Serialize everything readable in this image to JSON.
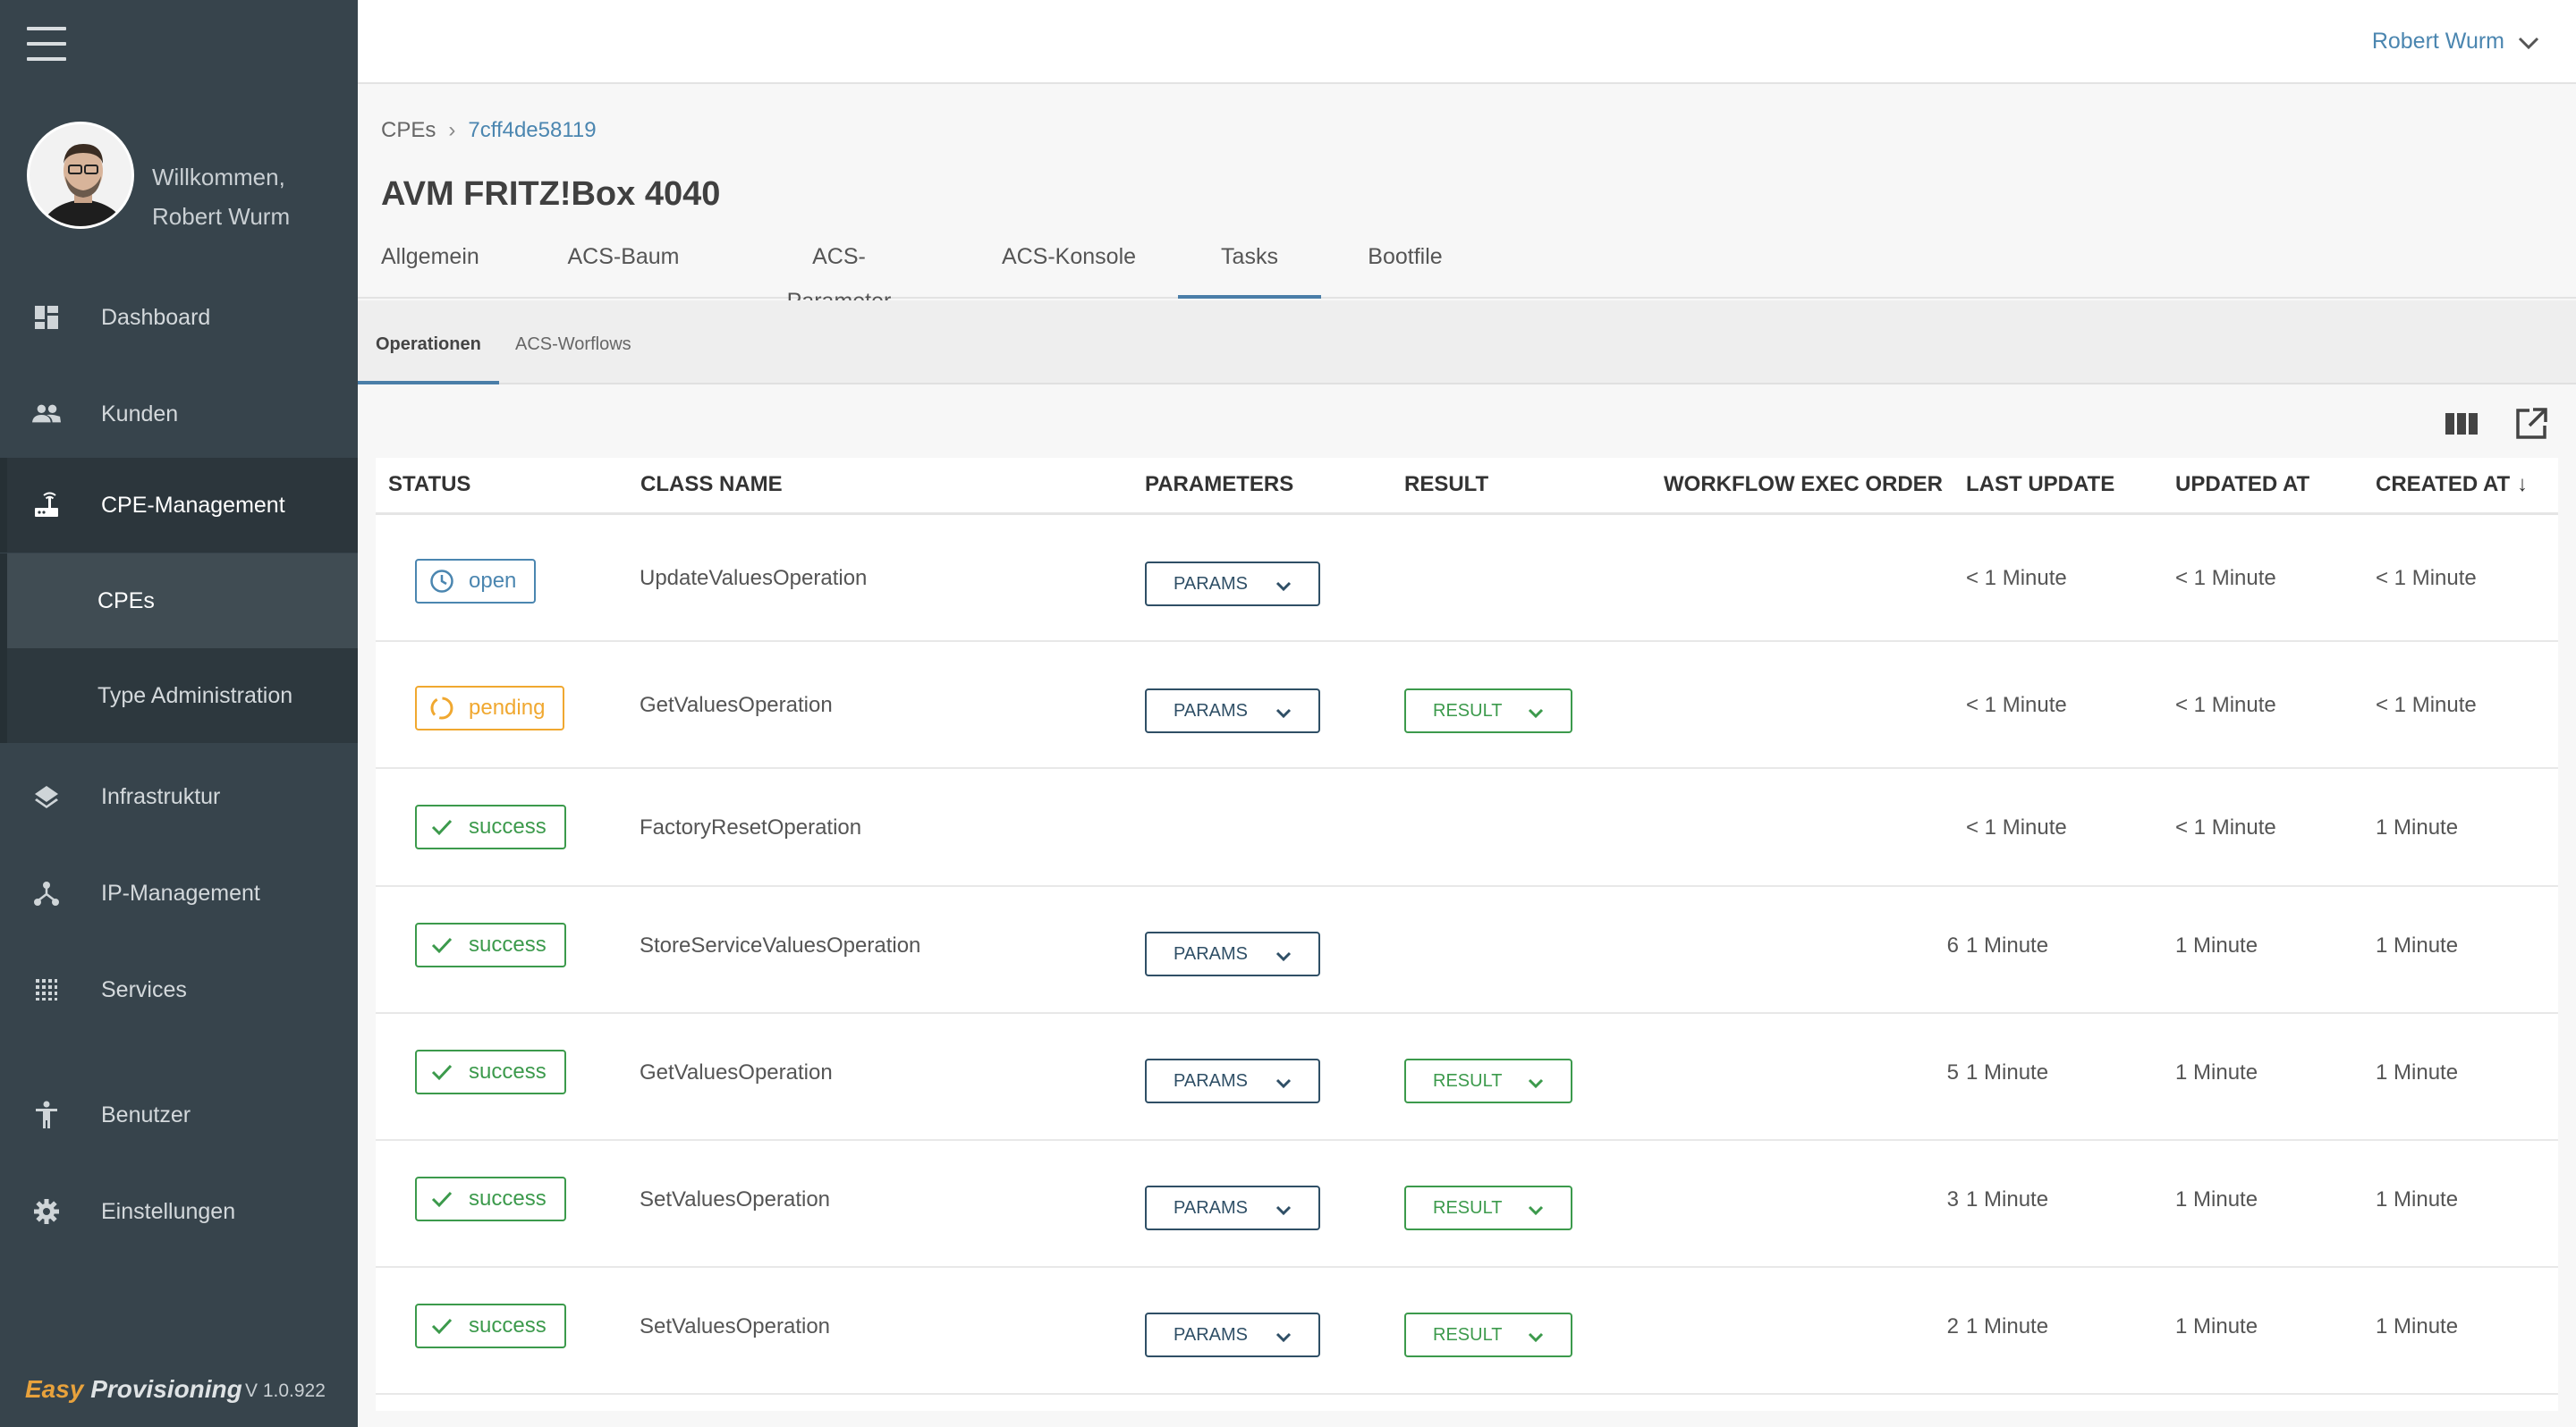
{
  "sidebar": {
    "welcome_line1": "Willkommen,",
    "welcome_line2": "Robert Wurm",
    "items": [
      {
        "label": "Dashboard",
        "icon": "dashboard-icon"
      },
      {
        "label": "Kunden",
        "icon": "people-icon"
      },
      {
        "label": "CPE-Management",
        "icon": "router-icon"
      },
      {
        "label": "CPEs"
      },
      {
        "label": "Type Administration"
      },
      {
        "label": "Infrastruktur",
        "icon": "layers-icon"
      },
      {
        "label": "IP-Management",
        "icon": "network-icon"
      },
      {
        "label": "Services",
        "icon": "grid-icon"
      },
      {
        "label": "Benutzer",
        "icon": "person-icon"
      },
      {
        "label": "Einstellungen",
        "icon": "gear-icon"
      }
    ],
    "brand_easy": "Easy",
    "brand_rest": "Provisioning",
    "version": "V 1.0.922"
  },
  "topbar": {
    "user": "Robert Wurm"
  },
  "breadcrumb": {
    "root": "CPEs",
    "sep": "›",
    "current": "7cff4de58119"
  },
  "title": "AVM FRITZ!Box 4040",
  "tabs": [
    "Allgemein",
    "ACS-Baum",
    "ACS-Parameter",
    "ACS-Konsole",
    "Tasks",
    "Bootfile"
  ],
  "subtabs": [
    "Operationen",
    "ACS-Worflows"
  ],
  "table": {
    "headers": [
      "STATUS",
      "CLASS NAME",
      "PARAMETERS",
      "RESULT",
      "WORKFLOW EXEC ORDER",
      "LAST UPDATE",
      "UPDATED AT",
      "CREATED AT",
      "↓"
    ],
    "params_label": "PARAMS",
    "result_label": "RESULT",
    "rows": [
      {
        "status": "open",
        "class": "UpdateValuesOperation",
        "order": "",
        "last": "< 1 Minute",
        "updated": "< 1 Minute",
        "created": "< 1 Minute"
      },
      {
        "status": "pending",
        "class": "GetValuesOperation",
        "order": "",
        "last": "< 1 Minute",
        "updated": "< 1 Minute",
        "created": "< 1 Minute"
      },
      {
        "status": "success",
        "class": "FactoryResetOperation",
        "order": "",
        "last": "< 1 Minute",
        "updated": "< 1 Minute",
        "created": "1 Minute"
      },
      {
        "status": "success",
        "class": "StoreServiceValuesOperation",
        "order": "6",
        "last": "1 Minute",
        "updated": "1 Minute",
        "created": "1 Minute"
      },
      {
        "status": "success",
        "class": "GetValuesOperation",
        "order": "5",
        "last": "1 Minute",
        "updated": "1 Minute",
        "created": "1 Minute"
      },
      {
        "status": "success",
        "class": "SetValuesOperation",
        "order": "3",
        "last": "1 Minute",
        "updated": "1 Minute",
        "created": "1 Minute"
      },
      {
        "status": "success",
        "class": "SetValuesOperation",
        "order": "2",
        "last": "1 Minute",
        "updated": "1 Minute",
        "created": "1 Minute"
      }
    ]
  },
  "colors": {
    "sidebar": "#37444c",
    "accent": "#4b86b0",
    "success": "#3c9a4c",
    "pending": "#f0a830",
    "params": "#2f4f66"
  }
}
